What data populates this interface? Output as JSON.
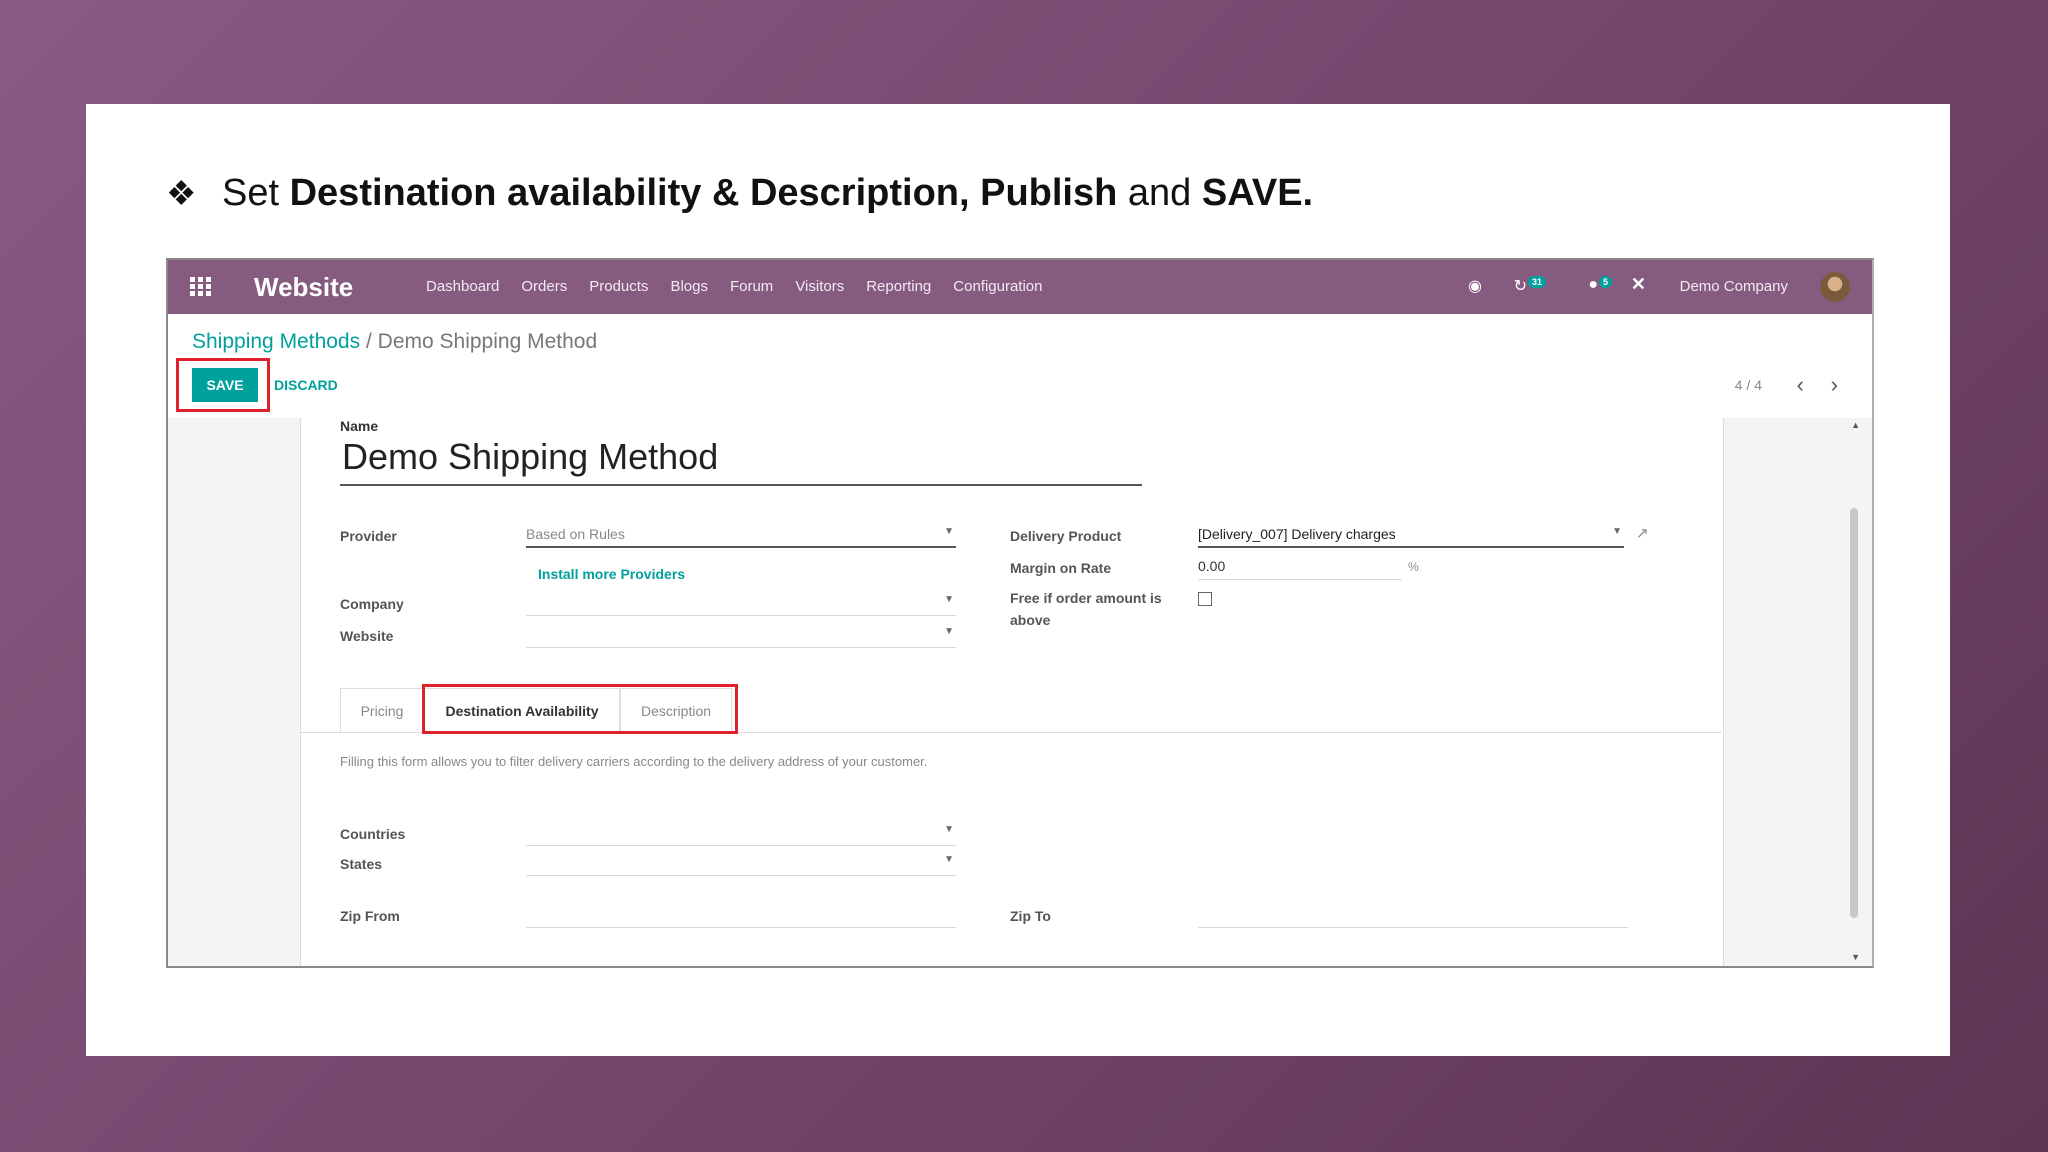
{
  "slide": {
    "bullet": "❖",
    "parts": [
      {
        "text": "Set ",
        "bold": false
      },
      {
        "text": "Destination availability & Description, Publish",
        "bold": true
      },
      {
        "text": " and ",
        "bold": false
      },
      {
        "text": "SAVE.",
        "bold": true
      }
    ]
  },
  "navbar": {
    "app_name": "Website",
    "menu": [
      "Dashboard",
      "Orders",
      "Products",
      "Blogs",
      "Forum",
      "Visitors",
      "Reporting",
      "Configuration"
    ],
    "activity_count": "31",
    "messages_count": "5",
    "company": "Demo Company",
    "icons": [
      "apps-icon",
      "bug-icon",
      "activity-icon",
      "chat-icon",
      "close-icon",
      "avatar"
    ]
  },
  "breadcrumb": {
    "parent": "Shipping Methods",
    "separator": "/",
    "current": "Demo Shipping Method"
  },
  "buttons": {
    "save": "SAVE",
    "discard": "DISCARD"
  },
  "pager": {
    "label": "4 / 4",
    "prev": "‹",
    "next": "›"
  },
  "form": {
    "name_label": "Name",
    "name_value": "Demo Shipping Method",
    "provider_label": "Provider",
    "provider_value": "Based on Rules",
    "install_link": "Install more Providers",
    "company_label": "Company",
    "company_value": "",
    "website_label": "Website",
    "website_value": "",
    "delivery_product_label": "Delivery Product",
    "delivery_product_value": "[Delivery_007] Delivery charges",
    "margin_label": "Margin on Rate",
    "margin_value": "0.00",
    "margin_unit": "%",
    "free_label_1": "Free if order amount is",
    "free_label_2": "above",
    "free_checked": false
  },
  "tabs": [
    {
      "label": "Pricing",
      "active": false
    },
    {
      "label": "Destination Availability",
      "active": true
    },
    {
      "label": "Description",
      "active": false
    }
  ],
  "destination": {
    "help": "Filling this form allows you to filter delivery carriers according to the delivery address of your customer.",
    "countries_label": "Countries",
    "states_label": "States",
    "zip_from_label": "Zip From",
    "zip_to_label": "Zip To"
  },
  "colors": {
    "brand": "#865b80",
    "accent": "#00a09d",
    "highlight": "#e0202a"
  }
}
